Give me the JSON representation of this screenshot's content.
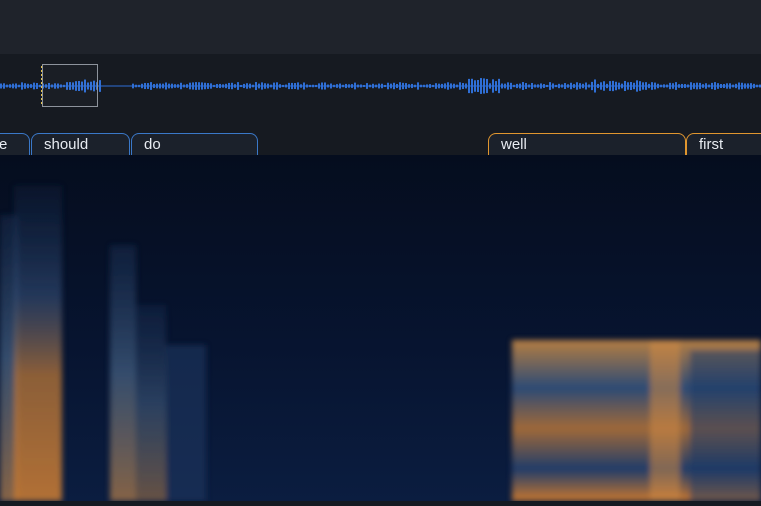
{
  "words": [
    {
      "text": "e",
      "selected": false
    },
    {
      "text": "should",
      "selected": false
    },
    {
      "text": "do",
      "selected": false
    },
    {
      "text": "well",
      "selected": true
    },
    {
      "text": "first",
      "selected": true
    }
  ],
  "colors": {
    "waveform": "#2f6fd6",
    "word_border": "#3a78c8",
    "selected_border": "#e0962f",
    "playhead": "#e6c34a",
    "spectrogram_low": "#07122a",
    "spectrogram_mid": "#2a4d7c",
    "spectrogram_high": "#d27a2c"
  }
}
